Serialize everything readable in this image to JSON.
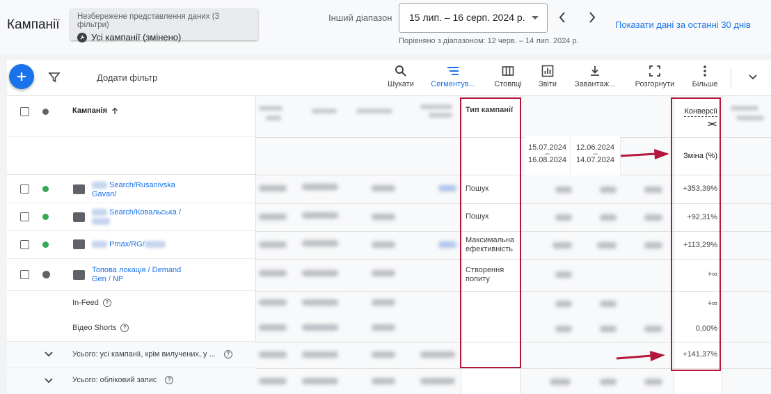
{
  "header": {
    "title": "Кампанії",
    "view_chip": {
      "subtitle": "Незбережене представлення даних (3 фільтри)",
      "label": "Усі кампанії (змінено)"
    },
    "range_label": "Інший діапазон",
    "date_range": "15 лип. – 16 серп. 2024 р.",
    "compare_text": "Порівняно з діапазоном: 12 черв. – 14 лип. 2024 р.",
    "last30_link": "Показати дані за останні 30 днів"
  },
  "toolbar": {
    "add_filter": "Додати фільтр",
    "buttons": [
      {
        "label": "Шукати",
        "icon": "search-icon"
      },
      {
        "label": "Сегментув...",
        "icon": "segment-icon",
        "active": true
      },
      {
        "label": "Стовпці",
        "icon": "columns-icon"
      },
      {
        "label": "Звіти",
        "icon": "reports-icon"
      },
      {
        "label": "Завантаж...",
        "icon": "download-icon"
      },
      {
        "label": "Розгорнути",
        "icon": "expand-icon"
      },
      {
        "label": "Більше",
        "icon": "more-vert-icon"
      }
    ]
  },
  "table": {
    "campaign_header": "Кампанія",
    "type_header": "Тип кампанії",
    "conv_header": "Конверсії",
    "conv_toggle": "><",
    "date_col_1": {
      "start": "15.07.2024",
      "dash": "–",
      "end": "16.08.2024"
    },
    "date_col_2": {
      "start": "12.06.2024",
      "dash": "–",
      "end": "14.07.2024"
    },
    "change_header": "Зміна (%)",
    "rows": [
      {
        "name": "Search/Rusanivska Gavan/",
        "type": "Пошук",
        "change": "+353,39%"
      },
      {
        "name": "Search/Ковальська /",
        "type": "Пошук",
        "change": "+92,31%"
      },
      {
        "name": "Pmax/RG/",
        "type": "Максимальна ефективність",
        "change": "+113,29%"
      },
      {
        "name": "Топова локація / Demand Gen / NP",
        "type": "Створення попиту",
        "change": "+∞"
      }
    ],
    "sub_rows": [
      {
        "label": "In-Feed",
        "change": "+∞"
      },
      {
        "label": "Відео Shorts",
        "change": "0,00%"
      }
    ],
    "totals": [
      {
        "label": "Усього: усі кампанії, крім вилучених, у ...",
        "change": "+141,37%"
      },
      {
        "label": "Усього: обліковий запис",
        "change": ""
      }
    ]
  },
  "colors": {
    "accent": "#1a73e8",
    "highlight_box": "#b3173c",
    "status_enabled": "#34a853"
  }
}
